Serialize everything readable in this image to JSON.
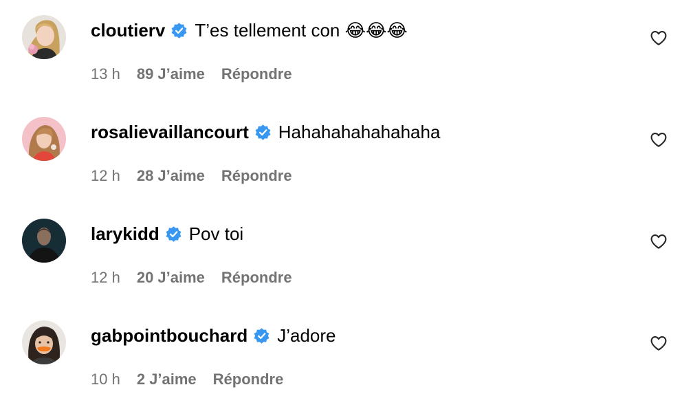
{
  "comments": [
    {
      "username": "cloutierv",
      "verified": true,
      "text": "T’es tellement con 😂😂😂",
      "time": "13 h",
      "likes": "89 J’aime",
      "reply_label": "Répondre",
      "avatar": "photo-blonde-woman"
    },
    {
      "username": "rosalievaillancourt",
      "verified": true,
      "text": "Hahahahahahahaha",
      "time": "12 h",
      "likes": "28 J’aime",
      "reply_label": "Répondre",
      "avatar": "photo-woman-pink-background"
    },
    {
      "username": "larykidd",
      "verified": true,
      "text": "Pov toi",
      "time": "12 h",
      "likes": "20 J’aime",
      "reply_label": "Répondre",
      "avatar": "photo-man-dark-background"
    },
    {
      "username": "gabpointbouchard",
      "verified": true,
      "text": "J’adore",
      "time": "10 h",
      "likes": "2 J’aime",
      "reply_label": "Répondre",
      "avatar": "photo-man-orange-mustache"
    }
  ],
  "icons": {
    "verified": "verified-badge-icon",
    "like": "heart-outline-icon"
  },
  "colors": {
    "verified_blue": "#3897f0",
    "meta_gray": "#737373",
    "text": "#000000",
    "background": "#ffffff"
  }
}
